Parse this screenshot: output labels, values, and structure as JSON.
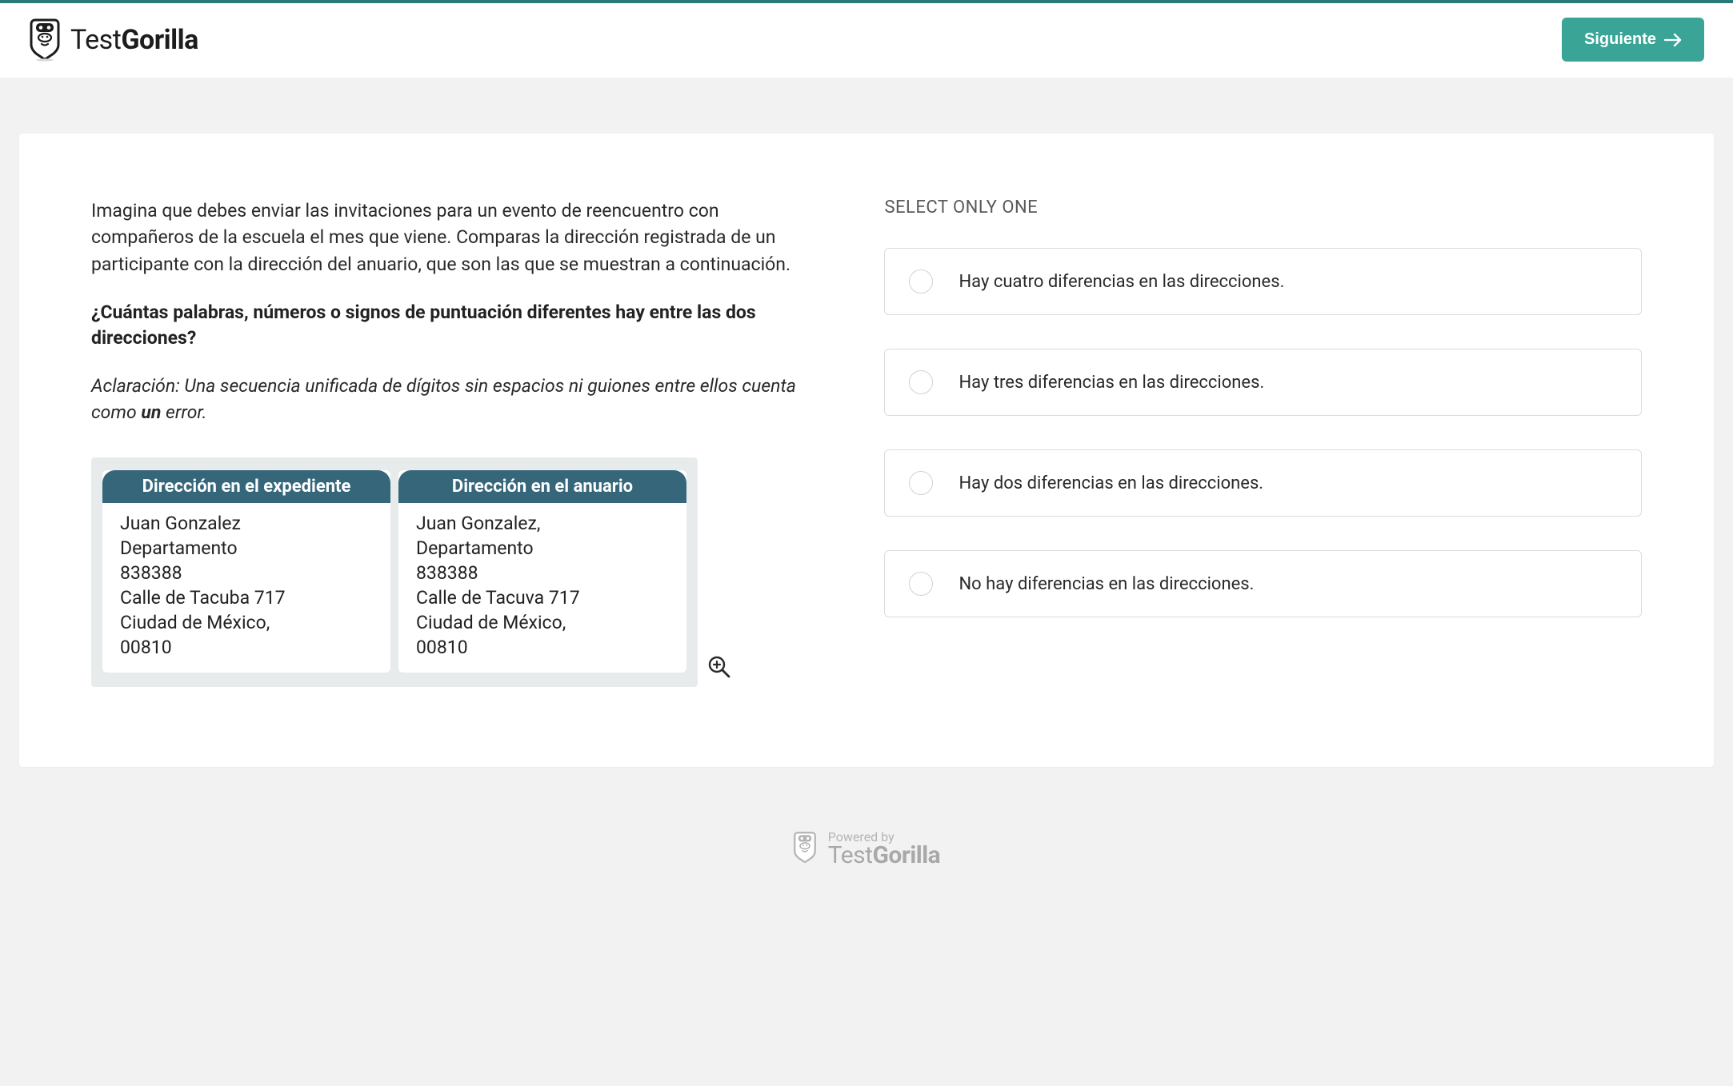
{
  "header": {
    "logo_text_prefix": "Test",
    "logo_text_bold": "Gorilla",
    "next_label": "Siguiente"
  },
  "question": {
    "intro": "Imagina que debes enviar las invitaciones para un evento de reencuentro con compañeros de la escuela el mes que viene. Comparas la dirección registrada de un participante con la dirección del anuario, que son las que se muestran a continuación.",
    "prompt": "¿Cuántas palabras, números o signos de puntuación diferentes hay entre las dos direcciones?",
    "clarification_prefix": "Aclaración: Una secuencia unificada de dígitos sin espacios ni guiones entre ellos cuenta como ",
    "clarification_bold": "un",
    "clarification_suffix": " error."
  },
  "compare": {
    "left_header": "Dirección en el expediente",
    "right_header": "Dirección en el anuario",
    "left_body": "Juan Gonzalez\nDepartamento\n838388\nCalle de Tacuba 717\nCiudad de México,\n00810",
    "right_body": "Juan Gonzalez,\nDepartamento\n838388\nCalle de Tacuva 717\nCiudad de México,\n00810"
  },
  "answers": {
    "heading": "SELECT ONLY ONE",
    "options": [
      "Hay cuatro diferencias en las direcciones.",
      "Hay tres diferencias en las direcciones.",
      "Hay dos diferencias en las direcciones.",
      "No hay diferencias en las direcciones."
    ]
  },
  "footer": {
    "powered_by": "Powered by",
    "logo_text_prefix": "Test",
    "logo_text_bold": "Gorilla"
  }
}
